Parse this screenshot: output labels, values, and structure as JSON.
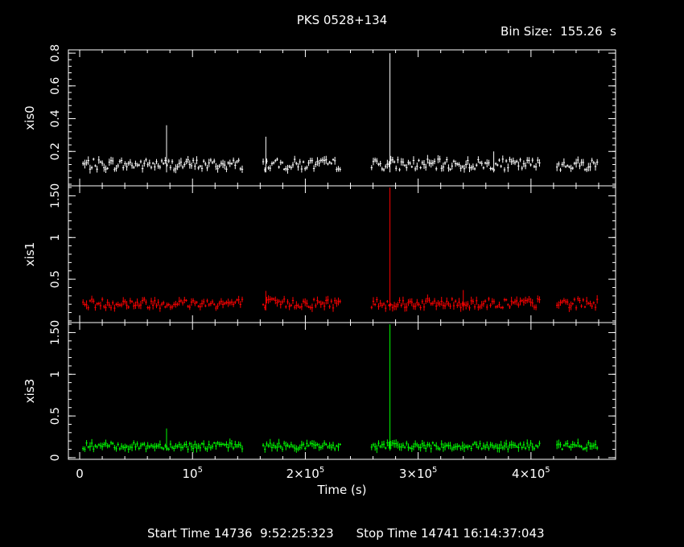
{
  "title": "PKS 0528+134",
  "bin_size_label": "Bin Size:  155.26  s",
  "footer": {
    "start": "Start Time 14736  9:52:25:323",
    "stop": "Stop Time 14741 16:14:37:043"
  },
  "chart_data": {
    "type": "line",
    "xlabel": "Time (s)",
    "xlim": [
      -10000,
      475000
    ],
    "x_ticks": [
      {
        "value": 0,
        "label": "0"
      },
      {
        "value": 100000,
        "label": "10⁵"
      },
      {
        "value": 200000,
        "label": "2×10⁵"
      },
      {
        "value": 300000,
        "label": "3×10⁵"
      },
      {
        "value": 400000,
        "label": "4×10⁵"
      }
    ],
    "gaps": [
      [
        145000,
        162000
      ],
      [
        232000,
        258000
      ],
      [
        409000,
        422000
      ]
    ],
    "panels": [
      {
        "name": "xis0",
        "color": "#ffffff",
        "ylim": [
          -0.01,
          0.82
        ],
        "y_ticks": [
          {
            "value": 0.2,
            "label": "0.2"
          },
          {
            "value": 0.4,
            "label": "0.4"
          },
          {
            "value": 0.6,
            "label": "0.6"
          },
          {
            "value": 0.8,
            "label": "0.8"
          }
        ],
        "baseline": 0.12,
        "spikes": [
          {
            "x": 77000,
            "y": 0.36
          },
          {
            "x": 165000,
            "y": 0.29
          },
          {
            "x": 275000,
            "y": 0.8
          },
          {
            "x": 367000,
            "y": 0.2
          }
        ]
      },
      {
        "name": "xis1",
        "color": "#ff0000",
        "ylim": [
          -0.02,
          1.62
        ],
        "y_ticks": [
          {
            "value": 0.5,
            "label": "0.5"
          },
          {
            "value": 1,
            "label": "1"
          },
          {
            "value": 1.5,
            "label": "1.50"
          }
        ],
        "baseline": 0.21,
        "spikes": [
          {
            "x": 275000,
            "y": 1.6
          },
          {
            "x": 340000,
            "y": 0.37
          },
          {
            "x": 165000,
            "y": 0.36
          }
        ]
      },
      {
        "name": "xis3",
        "color": "#00ff00",
        "ylim": [
          -0.02,
          1.62
        ],
        "y_ticks": [
          {
            "value": 0,
            "label": "0"
          },
          {
            "value": 0.5,
            "label": "0.5"
          },
          {
            "value": 1,
            "label": "1"
          },
          {
            "value": 1.5,
            "label": "1.50"
          }
        ],
        "baseline": 0.14,
        "spikes": [
          {
            "x": 77000,
            "y": 0.35
          },
          {
            "x": 275000,
            "y": 1.6
          }
        ]
      }
    ]
  }
}
